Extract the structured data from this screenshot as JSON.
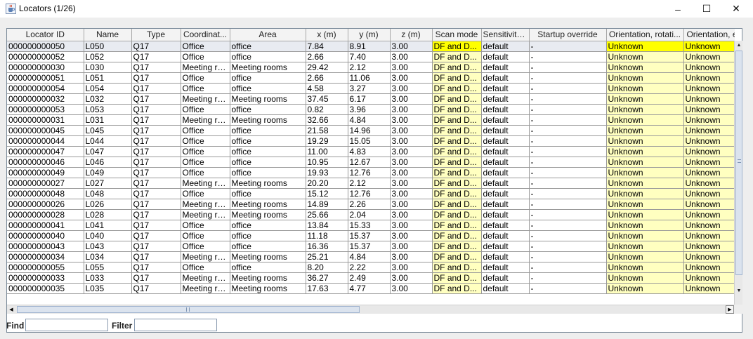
{
  "window": {
    "title": "Locators (1/26)",
    "controls": {
      "minimize": "–",
      "maximize": "☐",
      "close": "✕"
    }
  },
  "colors": {
    "selected_highlight": "#ffff00",
    "highlight": "#ffffc0",
    "selected_row": "#e8ebf1"
  },
  "table": {
    "columns": [
      "Locator ID",
      "Name",
      "Type",
      "Coordinat...",
      "Area",
      "x (m)",
      "y (m)",
      "z (m)",
      "Scan mode",
      "Sensitivity ...",
      "Startup override",
      "Orientation, rotati...",
      "Orientation, e"
    ],
    "rows": [
      [
        "000000000050",
        "L050",
        "Q17",
        "Office",
        "office",
        "7.84",
        "8.91",
        "3.00",
        "DF and D...",
        "default",
        "-",
        "Unknown",
        "Unknown"
      ],
      [
        "000000000052",
        "L052",
        "Q17",
        "Office",
        "office",
        "2.66",
        "7.40",
        "3.00",
        "DF and D...",
        "default",
        "-",
        "Unknown",
        "Unknown"
      ],
      [
        "000000000030",
        "L030",
        "Q17",
        "Meeting ro...",
        "Meeting rooms",
        "29.42",
        "2.12",
        "3.00",
        "DF and D...",
        "default",
        "-",
        "Unknown",
        "Unknown"
      ],
      [
        "000000000051",
        "L051",
        "Q17",
        "Office",
        "office",
        "2.66",
        "11.06",
        "3.00",
        "DF and D...",
        "default",
        "-",
        "Unknown",
        "Unknown"
      ],
      [
        "000000000054",
        "L054",
        "Q17",
        "Office",
        "office",
        "4.58",
        "3.27",
        "3.00",
        "DF and D...",
        "default",
        "-",
        "Unknown",
        "Unknown"
      ],
      [
        "000000000032",
        "L032",
        "Q17",
        "Meeting ro...",
        "Meeting rooms",
        "37.45",
        "6.17",
        "3.00",
        "DF and D...",
        "default",
        "-",
        "Unknown",
        "Unknown"
      ],
      [
        "000000000053",
        "L053",
        "Q17",
        "Office",
        "office",
        "0.82",
        "3.96",
        "3.00",
        "DF and D...",
        "default",
        "-",
        "Unknown",
        "Unknown"
      ],
      [
        "000000000031",
        "L031",
        "Q17",
        "Meeting ro...",
        "Meeting rooms",
        "32.66",
        "4.84",
        "3.00",
        "DF and D...",
        "default",
        "-",
        "Unknown",
        "Unknown"
      ],
      [
        "000000000045",
        "L045",
        "Q17",
        "Office",
        "office",
        "21.58",
        "14.96",
        "3.00",
        "DF and D...",
        "default",
        "-",
        "Unknown",
        "Unknown"
      ],
      [
        "000000000044",
        "L044",
        "Q17",
        "Office",
        "office",
        "19.29",
        "15.05",
        "3.00",
        "DF and D...",
        "default",
        "-",
        "Unknown",
        "Unknown"
      ],
      [
        "000000000047",
        "L047",
        "Q17",
        "Office",
        "office",
        "11.00",
        "4.83",
        "3.00",
        "DF and D...",
        "default",
        "-",
        "Unknown",
        "Unknown"
      ],
      [
        "000000000046",
        "L046",
        "Q17",
        "Office",
        "office",
        "10.95",
        "12.67",
        "3.00",
        "DF and D...",
        "default",
        "-",
        "Unknown",
        "Unknown"
      ],
      [
        "000000000049",
        "L049",
        "Q17",
        "Office",
        "office",
        "19.93",
        "12.76",
        "3.00",
        "DF and D...",
        "default",
        "-",
        "Unknown",
        "Unknown"
      ],
      [
        "000000000027",
        "L027",
        "Q17",
        "Meeting ro...",
        "Meeting rooms",
        "20.20",
        "2.12",
        "3.00",
        "DF and D...",
        "default",
        "-",
        "Unknown",
        "Unknown"
      ],
      [
        "000000000048",
        "L048",
        "Q17",
        "Office",
        "office",
        "15.12",
        "12.76",
        "3.00",
        "DF and D...",
        "default",
        "-",
        "Unknown",
        "Unknown"
      ],
      [
        "000000000026",
        "L026",
        "Q17",
        "Meeting ro...",
        "Meeting rooms",
        "14.89",
        "2.26",
        "3.00",
        "DF and D...",
        "default",
        "-",
        "Unknown",
        "Unknown"
      ],
      [
        "000000000028",
        "L028",
        "Q17",
        "Meeting ro...",
        "Meeting rooms",
        "25.66",
        "2.04",
        "3.00",
        "DF and D...",
        "default",
        "-",
        "Unknown",
        "Unknown"
      ],
      [
        "000000000041",
        "L041",
        "Q17",
        "Office",
        "office",
        "13.84",
        "15.33",
        "3.00",
        "DF and D...",
        "default",
        "-",
        "Unknown",
        "Unknown"
      ],
      [
        "000000000040",
        "L040",
        "Q17",
        "Office",
        "office",
        "11.18",
        "15.37",
        "3.00",
        "DF and D...",
        "default",
        "-",
        "Unknown",
        "Unknown"
      ],
      [
        "000000000043",
        "L043",
        "Q17",
        "Office",
        "office",
        "16.36",
        "15.37",
        "3.00",
        "DF and D...",
        "default",
        "-",
        "Unknown",
        "Unknown"
      ],
      [
        "000000000034",
        "L034",
        "Q17",
        "Meeting ro...",
        "Meeting rooms",
        "25.21",
        "4.84",
        "3.00",
        "DF and D...",
        "default",
        "-",
        "Unknown",
        "Unknown"
      ],
      [
        "000000000055",
        "L055",
        "Q17",
        "Office",
        "office",
        "8.20",
        "2.22",
        "3.00",
        "DF and D...",
        "default",
        "-",
        "Unknown",
        "Unknown"
      ],
      [
        "000000000033",
        "L033",
        "Q17",
        "Meeting ro...",
        "Meeting rooms",
        "36.27",
        "2.49",
        "3.00",
        "DF and D...",
        "default",
        "-",
        "Unknown",
        "Unknown"
      ],
      [
        "000000000035",
        "L035",
        "Q17",
        "Meeting ro...",
        "Meeting rooms",
        "17.63",
        "4.77",
        "3.00",
        "DF and D...",
        "default",
        "-",
        "Unknown",
        "Unknown"
      ]
    ],
    "selected_row": 0
  },
  "bottom": {
    "find_label": "Find",
    "filter_label": "Filter",
    "find_value": "",
    "filter_value": ""
  }
}
